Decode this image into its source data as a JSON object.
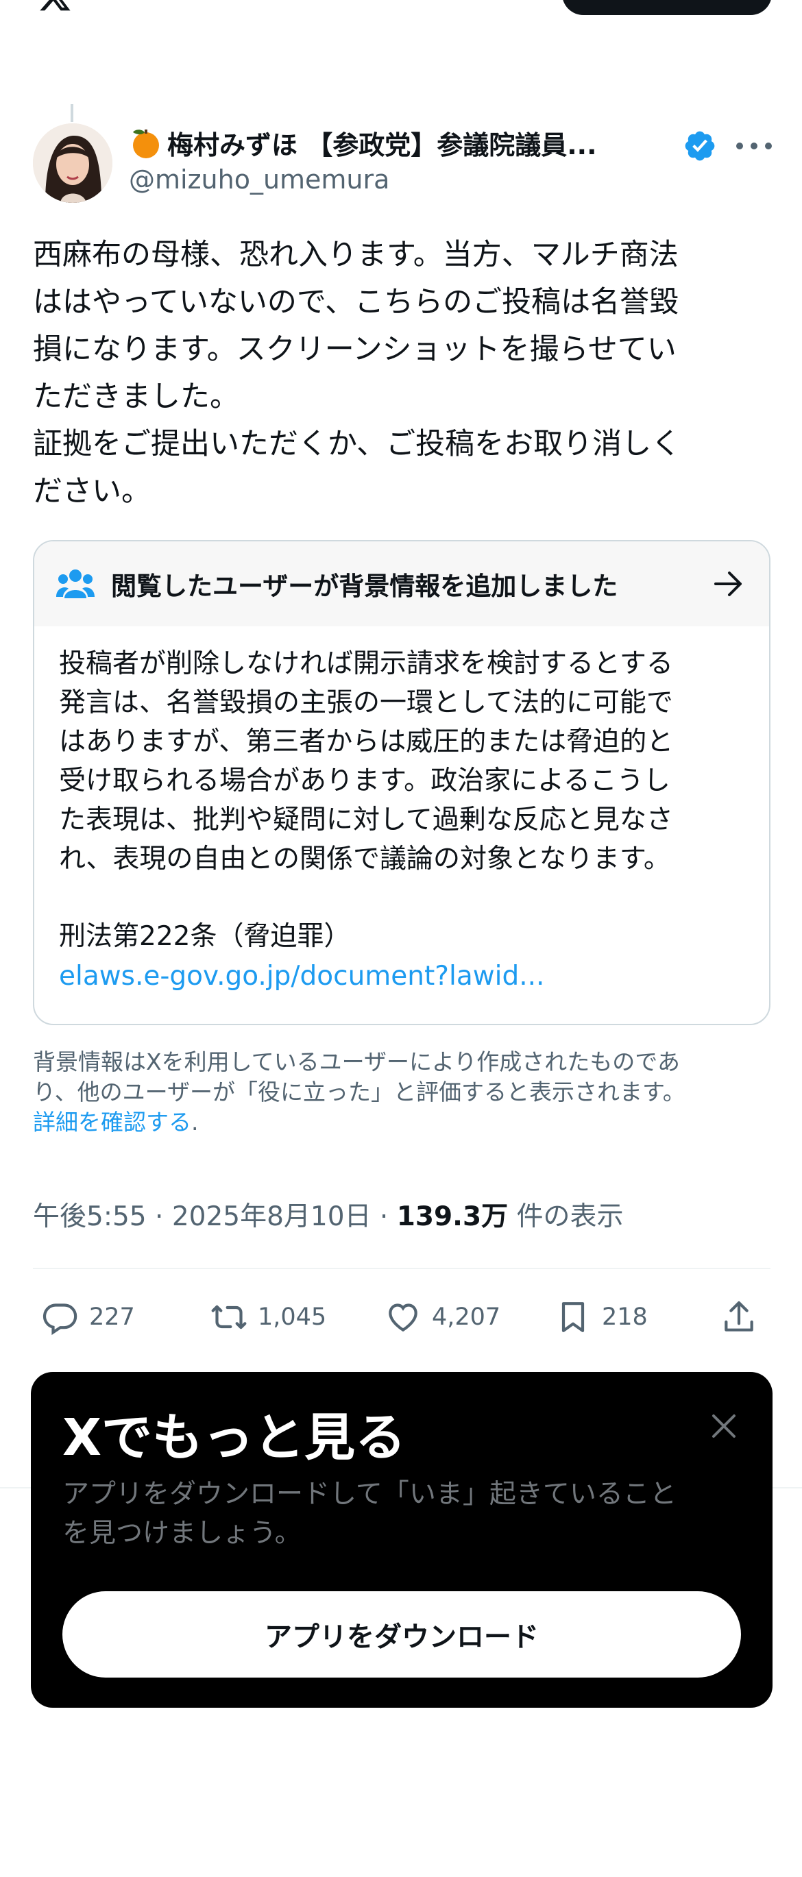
{
  "tweet": {
    "display_name": "梅村みずほ 【参政党】参議院議員...",
    "handle": "@mizuho_umemura",
    "text": "西麻布の母様、恐れ入ります。当方、マルチ商法\nははやっていないので、こちらのご投稿は名誉毀\n損になります。スクリーンショットを撮らせてい\nただきました。\n証拠をご提出いただくか、ご投稿をお取り消しく\nださい。",
    "time": "午後5:55",
    "date": "2025年8月10日",
    "views_count": "139.3万",
    "views_label": "件の表示",
    "sep": "·"
  },
  "note": {
    "title": "閲覧したユーザーが背景情報を追加しました",
    "body": "投稿者が削除しなければ開示請求を検討するとする\n発言は、名誉毀損の主張の一環として法的に可能で\nはありますが、第三者からは威圧的または脅迫的と\n受け取られる場合があります。政治家によるこうし\nた表現は、批判や疑問に対して過剰な反応と見なさ\nれ、表現の自由との関係で議論の対象となります。",
    "law": "刑法第222条（脅迫罪）",
    "link": "elaws.e-gov.go.jp/document?lawid...",
    "footer": "背景情報はXを利用しているユーザーにより作成されたものであ\nり、他のユーザーが「役に立った」と評価すると表示されます。",
    "footer_link": "詳細を確認する",
    "footer_end": "."
  },
  "actions": {
    "replies": "227",
    "reposts": "1,045",
    "likes": "4,207",
    "bookmarks": "218"
  },
  "sheet": {
    "title": "Xでもっと見る",
    "subtitle": "アプリをダウンロードして「いま」起きていること\nを見つけましょう。",
    "button": "アプリをダウンロード"
  },
  "colors": {
    "accent": "#1d9bf0",
    "muted": "#536471",
    "text": "#0f1419"
  }
}
